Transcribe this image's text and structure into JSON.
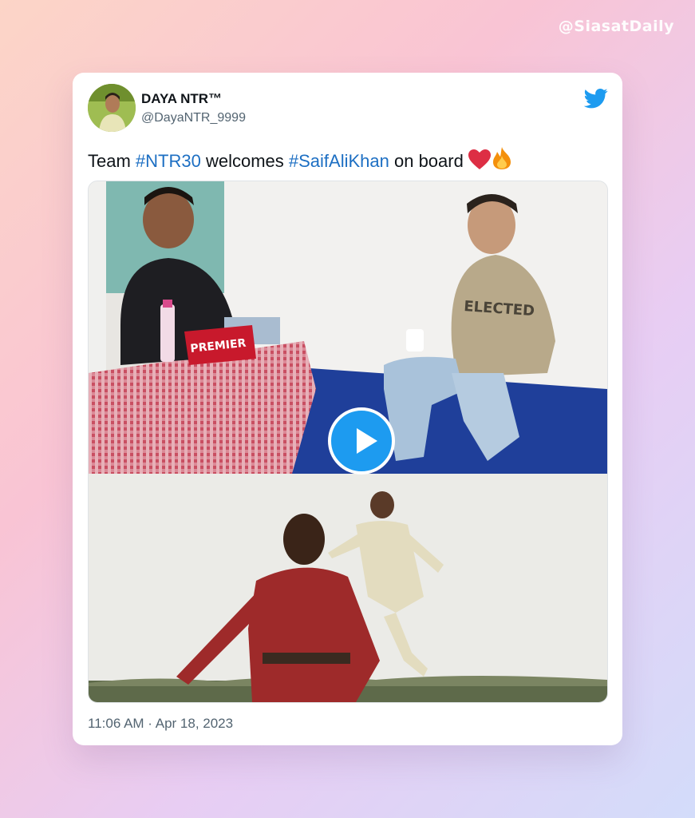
{
  "watermark": "@SiasatDaily",
  "tweet": {
    "author_name": "DAYA NTR™",
    "author_handle": "@DayaNTR_9999",
    "text_parts": {
      "t1": "Team ",
      "h1": "#NTR30",
      "t2": " welcomes ",
      "h2": "#SaifAliKhan",
      "t3": " on board "
    },
    "timestamp": "11:06 AM · Apr 18, 2023"
  },
  "media": {
    "top_tissue_box_text": "PREMIER",
    "top_shirt_text": "ELECTED"
  },
  "colors": {
    "hashtag": "#1d6fc3",
    "twitter_blue": "#1d9bf0"
  },
  "icons": [
    "twitter-bird-icon",
    "play-icon",
    "red-heart-emoji",
    "fire-emoji"
  ]
}
